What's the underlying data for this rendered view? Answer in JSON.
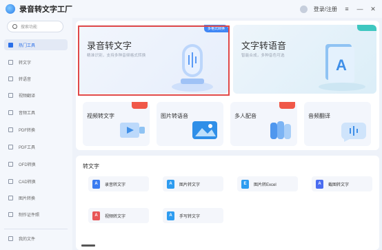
{
  "app": {
    "title": "录音转文字工厂"
  },
  "titlebar": {
    "login_label": "登录/注册",
    "menu_icon": "menu-icon",
    "min_icon": "minimize-icon",
    "close_icon": "close-icon"
  },
  "sidebar": {
    "search_placeholder": "搜索功能",
    "items": [
      {
        "label": "热门工具",
        "icon": "home-icon",
        "active": true
      },
      {
        "label": "转文字",
        "icon": "text-icon",
        "active": false
      },
      {
        "label": "转语音",
        "icon": "speaker-icon",
        "active": false
      },
      {
        "label": "视频翻译",
        "icon": "translate-icon",
        "active": false
      },
      {
        "label": "音频工具",
        "icon": "audio-icon",
        "active": false
      },
      {
        "label": "PDF转换",
        "icon": "pdf-icon",
        "active": false
      },
      {
        "label": "PDF工具",
        "icon": "pdf-tool-icon",
        "active": false
      },
      {
        "label": "OFD转换",
        "icon": "ofd-icon",
        "active": false
      },
      {
        "label": "CAD转换",
        "icon": "cad-icon",
        "active": false
      },
      {
        "label": "图片转换",
        "icon": "image-icon",
        "active": false
      },
      {
        "label": "制作证件照",
        "icon": "photo-id-icon",
        "active": false
      },
      {
        "label": "我的文件",
        "icon": "folder-icon",
        "active": false
      }
    ]
  },
  "featured": [
    {
      "title": "录音转文字",
      "desc": "精准识别，支持多种音频格式转换",
      "badge": "多格式转换"
    },
    {
      "title": "文字转语音",
      "desc": "智能合成，多种音色可选",
      "badge": ""
    }
  ],
  "small_cards": [
    {
      "label": "视频转文字",
      "badge": true
    },
    {
      "label": "图片转语音",
      "badge": false
    },
    {
      "label": "多人配音",
      "badge": true
    },
    {
      "label": "音频翻译",
      "badge": false
    }
  ],
  "section": {
    "title": "转文字",
    "tools": [
      {
        "label": "录音转文字",
        "icon_letter": "A",
        "color": "#3a7bf0"
      },
      {
        "label": "图片转文字",
        "icon_letter": "A",
        "color": "#2e9cf0"
      },
      {
        "label": "图片转Excel",
        "icon_letter": "E",
        "color": "#2e9cf0"
      },
      {
        "label": "截图转文字",
        "icon_letter": "A",
        "color": "#4a6cf0"
      },
      {
        "label": "视频转文字",
        "icon_letter": "A",
        "color": "#e85656"
      },
      {
        "label": "手写转文字",
        "icon_letter": "A",
        "color": "#2e9cf0"
      }
    ]
  },
  "colors": {
    "accent": "#2a6fe8",
    "badge_red": "#f05848",
    "selection": "#e04848"
  }
}
